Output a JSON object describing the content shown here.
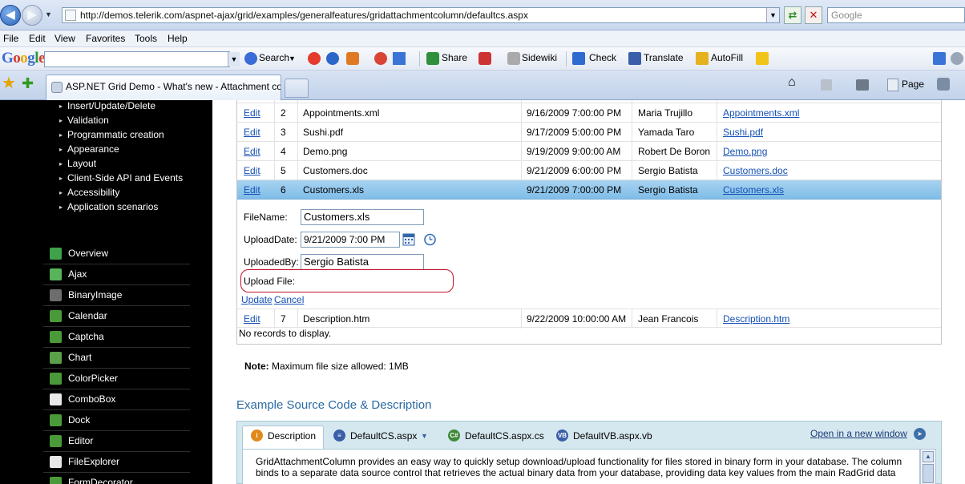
{
  "browser": {
    "url": "http://demos.telerik.com/aspnet-ajax/grid/examples/generalfeatures/gridattachmentcolumn/defaultcs.aspx",
    "search_placeholder": "Google",
    "menu": [
      "File",
      "Edit",
      "View",
      "Favorites",
      "Tools",
      "Help"
    ],
    "google_toolbar": {
      "logo": "Google",
      "search": "Search",
      "share": "Share",
      "sidewiki": "Sidewiki",
      "check": "Check",
      "translate": "Translate",
      "autofill": "AutoFill"
    },
    "tab_title": "ASP.NET Grid Demo - What's new - Attachment column",
    "page_menu": "Page"
  },
  "sidebar": {
    "sub_items": [
      "Insert/Update/Delete",
      "Validation",
      "Programmatic creation",
      "Appearance",
      "Layout",
      "Client-Side API and Events",
      "Accessibility",
      "Application scenarios"
    ],
    "controls": [
      {
        "label": "Overview",
        "icon": "overview-icon",
        "color": "#3fa14a"
      },
      {
        "label": "Ajax",
        "icon": "ajax-icon",
        "color": "#58b35a"
      },
      {
        "label": "BinaryImage",
        "icon": "binaryimage-icon",
        "color": "#6d6d6d"
      },
      {
        "label": "Calendar",
        "icon": "calendar-icon",
        "color": "#4a9a3a"
      },
      {
        "label": "Captcha",
        "icon": "captcha-icon",
        "color": "#4a9a3a"
      },
      {
        "label": "Chart",
        "icon": "chart-icon",
        "color": "#5aa04a"
      },
      {
        "label": "ColorPicker",
        "icon": "colorpicker-icon",
        "color": "#4a9a3a"
      },
      {
        "label": "ComboBox",
        "icon": "combobox-icon",
        "color": "#e8e8e8"
      },
      {
        "label": "Dock",
        "icon": "dock-icon",
        "color": "#4a9a3a"
      },
      {
        "label": "Editor",
        "icon": "editor-icon",
        "color": "#4a9a3a"
      },
      {
        "label": "FileExplorer",
        "icon": "fileexplorer-icon",
        "color": "#e8e8e8"
      },
      {
        "label": "FormDecorator",
        "icon": "formdecorator-icon",
        "color": "#4a9a3a"
      }
    ]
  },
  "grid": {
    "edit_link": "Edit",
    "rows": [
      {
        "id": "2",
        "file": "Appointments.xml",
        "date": "9/16/2009 7:00:00 PM",
        "by": "Maria Trujillo",
        "link": "Appointments.xml"
      },
      {
        "id": "3",
        "file": "Sushi.pdf",
        "date": "9/17/2009 5:00:00 PM",
        "by": "Yamada Taro",
        "link": "Sushi.pdf"
      },
      {
        "id": "4",
        "file": "Demo.png",
        "date": "9/19/2009 9:00:00 AM",
        "by": "Robert De Boron",
        "link": "Demo.png"
      },
      {
        "id": "5",
        "file": "Customers.doc",
        "date": "9/21/2009 6:00:00 PM",
        "by": "Sergio Batista",
        "link": "Customers.doc"
      },
      {
        "id": "6",
        "file": "Customers.xls",
        "date": "9/21/2009 7:00:00 PM",
        "by": "Sergio Batista",
        "link": "Customers.xls"
      }
    ],
    "edit_form": {
      "filename_label": "FileName:",
      "filename_value": "Customers.xls",
      "uploaddate_label": "UploadDate:",
      "uploaddate_value": "9/21/2009 7:00 PM",
      "uploadedby_label": "UploadedBy:",
      "uploadedby_value": "Sergio Batista",
      "uploadfile_label": "Upload File:",
      "update": "Update",
      "cancel": "Cancel"
    },
    "last_row": {
      "id": "7",
      "file": "Description.htm",
      "date": "9/22/2009 10:00:00 AM",
      "by": "Jean Francois",
      "link": "Description.htm"
    },
    "no_records": "No records to display."
  },
  "note": {
    "bold": "Note:",
    "text": "Maximum file size allowed: 1MB"
  },
  "source": {
    "title": "Example Source Code & Description",
    "tabs": [
      "Description",
      "DefaultCS.aspx",
      "DefaultCS.aspx.cs",
      "DefaultVB.aspx.vb"
    ],
    "open_link": "Open in a new window",
    "body_line1": "GridAttachmentColumn provides an easy way to quickly setup download/upload functionality for files stored in binary form in your database. The column",
    "body_line2": "binds to a separate data source control that retrieves the actual binary data from your database, providing data key values from the main RadGrid data"
  },
  "colors": {
    "accent_link": "#1450b4",
    "selected_row": "#7fbde8",
    "sidebar_bg": "#000000",
    "highlight_ring": "#c0102a"
  }
}
